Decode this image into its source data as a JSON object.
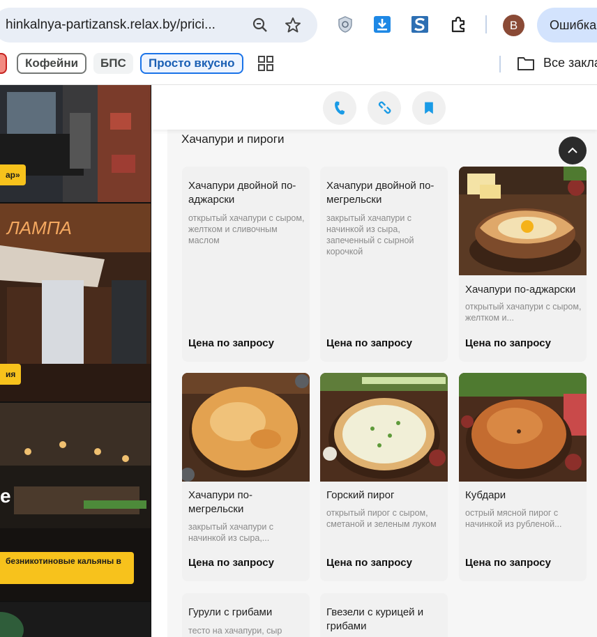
{
  "browser": {
    "url": "hinkalnya-partizansk.relax.by/prici...",
    "avatar_letter": "B",
    "error_label": "Ошибка",
    "icons": [
      "zoom-icon",
      "star-icon",
      "shield-extension-icon",
      "download-extension-icon",
      "s-extension-icon",
      "puzzle-extensions-icon"
    ]
  },
  "bookmarks": {
    "items": [
      "Кофейни",
      "БПС",
      "Просто вкусно"
    ],
    "all_bookmarks": "Все закла"
  },
  "left_promos": {
    "tag1": "ар»",
    "neon_sign": "ЛАМПА",
    "tag2": "ия",
    "big_letter": "е",
    "tag3": "безникотиновые кальяны в"
  },
  "section": {
    "title": "Хачапури и пироги"
  },
  "cards": [
    {
      "name": "Хачапури двойной по-аджарски",
      "desc": "открытый хачапури с сыром, желтком и сливочным маслом",
      "price": "Цена по запросу"
    },
    {
      "name": "Хачапури двойной по-мегрельски",
      "desc": "закрытый хачапури с начинкой из сыра, запеченный с сырной корочкой",
      "price": "Цена по запросу"
    },
    {
      "name": "Хачапури по-аджарски",
      "desc": "открытый хачапури с сыром, желтком и...",
      "price": "Цена по запросу"
    },
    {
      "name": "Хачапури по-мегрельски",
      "desc": "закрытый хачапури с начинкой из сыра,...",
      "price": "Цена по запросу"
    },
    {
      "name": "Горский пирог",
      "desc": "открытый пирог с сыром, сметаной и зеленым луком",
      "price": "Цена по запросу"
    },
    {
      "name": "Кубдари",
      "desc": "острый мясной пирог с начинкой из рубленой...",
      "price": "Цена по запросу"
    },
    {
      "name": "Гурули с грибами",
      "desc": "тесто на хачапури, сыр",
      "price": ""
    },
    {
      "name": "Гвезели с курицей и грибами",
      "desc": "",
      "price": ""
    }
  ],
  "colors": {
    "accent_yellow": "#f7c21c",
    "action_icon_blue": "#1a9be6",
    "card_bg": "#f1f1f1"
  }
}
